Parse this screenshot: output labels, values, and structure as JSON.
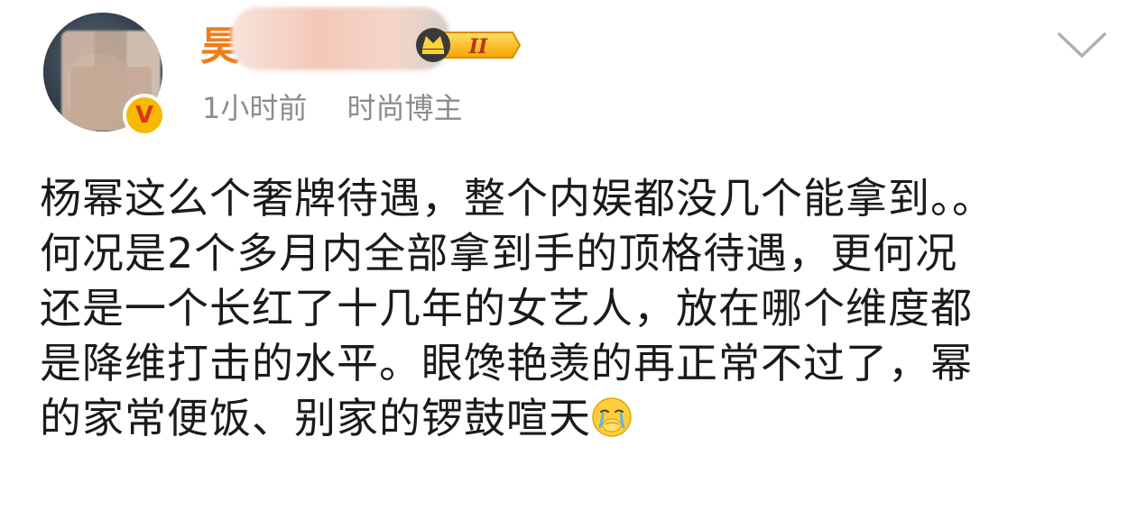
{
  "author": {
    "name_visible": "昊",
    "verified_icon": "verified-v-icon",
    "vip_label": "II",
    "time": "1小时前",
    "tag": "时尚博主"
  },
  "post": {
    "lines": [
      "杨幂这么个奢牌待遇，整个内娱都没几个能拿到。。",
      "何况是2个多月内全部拿到手的顶格待遇，更何况",
      "还是一个长红了十几年的女艺人，放在哪个维度都",
      "是降维打击的水平。眼馋艳羡的再正常不过了，幂",
      "的家常便饭、别家的锣鼓喧天"
    ],
    "trailing_emoji": "crying-face-emoji"
  },
  "colors": {
    "name": "#f07c1a",
    "meta": "#8c8c8c",
    "text": "#1a1a1a",
    "badge": "#f7b900"
  }
}
